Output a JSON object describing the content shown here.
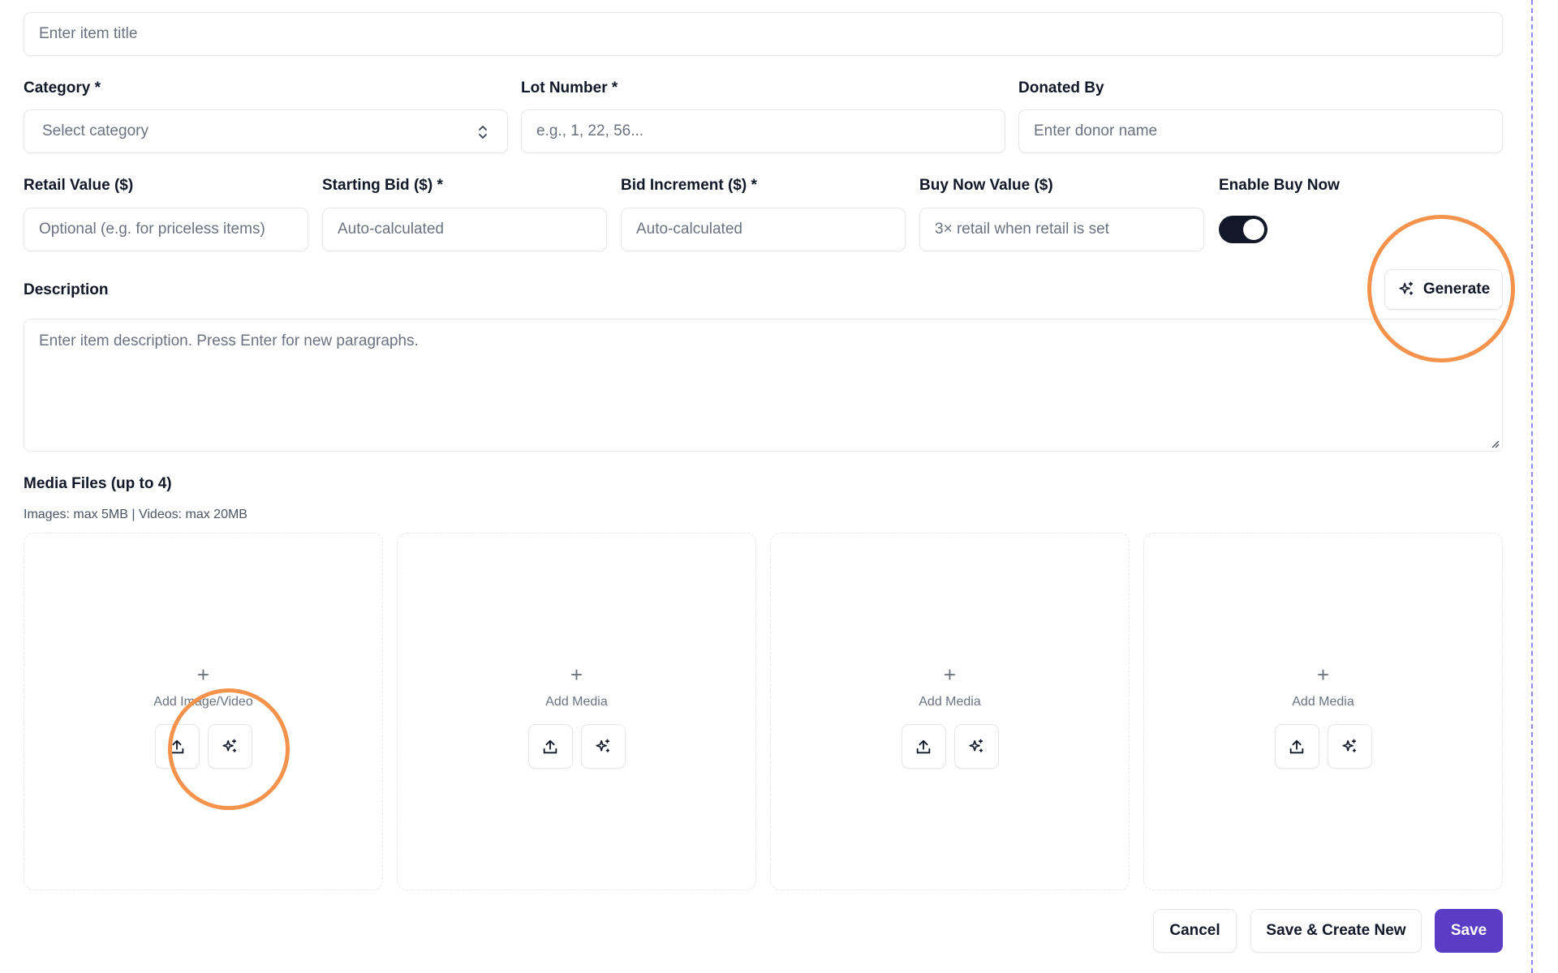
{
  "title_field": {
    "placeholder": "Enter item title"
  },
  "category": {
    "label": "Category *",
    "placeholder": "Select category"
  },
  "lot_number": {
    "label": "Lot Number *",
    "placeholder": "e.g., 1, 22, 56..."
  },
  "donated_by": {
    "label": "Donated By",
    "placeholder": "Enter donor name"
  },
  "retail_value": {
    "label": "Retail Value ($)",
    "placeholder": "Optional (e.g. for priceless items)"
  },
  "starting_bid": {
    "label": "Starting Bid ($) *",
    "placeholder": "Auto-calculated"
  },
  "bid_increment": {
    "label": "Bid Increment ($) *",
    "placeholder": "Auto-calculated"
  },
  "buy_now_value": {
    "label": "Buy Now Value ($)",
    "placeholder": "3× retail when retail is set"
  },
  "enable_buy_now": {
    "label": "Enable Buy Now",
    "checked": true
  },
  "description": {
    "label": "Description",
    "generate_label": "Generate",
    "placeholder": "Enter item description. Press Enter for new paragraphs."
  },
  "media": {
    "label": "Media Files (up to 4)",
    "hint": "Images: max 5MB | Videos: max 20MB",
    "slots": [
      {
        "label": "Add Image/Video"
      },
      {
        "label": "Add Media"
      },
      {
        "label": "Add Media"
      },
      {
        "label": "Add Media"
      }
    ]
  },
  "actions": {
    "cancel": "Cancel",
    "save_create_new": "Save & Create New",
    "save": "Save"
  },
  "colors": {
    "primary": "#5b3cc4",
    "toggle_on": "#111827",
    "annotation": "#f5934d",
    "guide": "#8b8cf0"
  },
  "icons": {
    "upload": "upload-icon",
    "sparkle": "sparkle-icon",
    "plus": "plus-icon",
    "chevron": "chevron-up-down-icon"
  }
}
